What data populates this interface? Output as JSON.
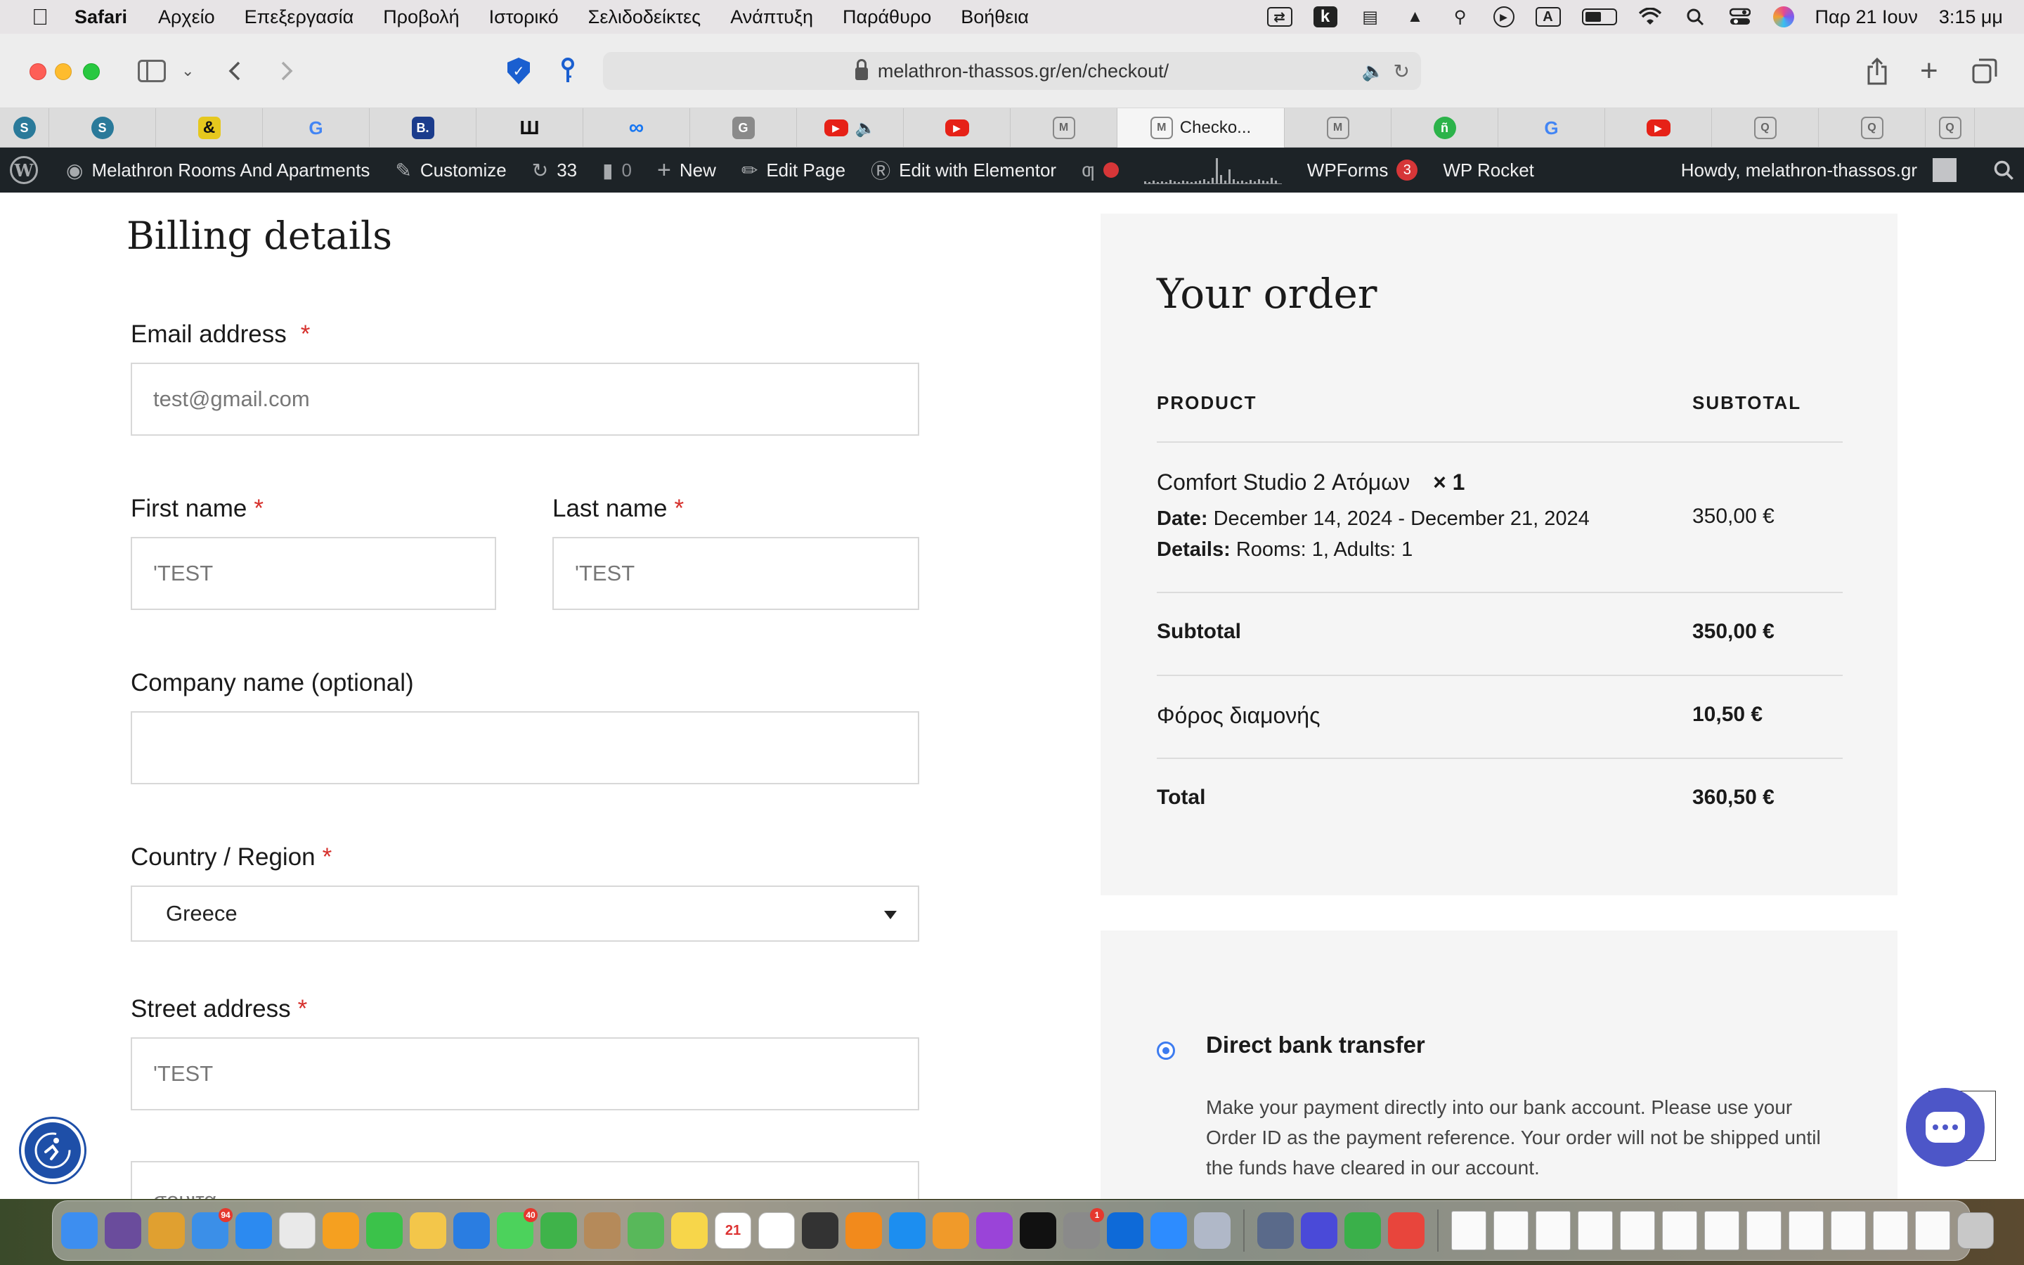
{
  "menubar": {
    "app_name": "Safari",
    "menus": [
      "Αρχείο",
      "Επεξεργασία",
      "Προβολή",
      "Ιστορικό",
      "Σελιδοδείκτες",
      "Ανάπτυξη",
      "Παράθυρο",
      "Βοήθεια"
    ],
    "date": "Παρ 21 Ιουν",
    "time": "3:15 μμ",
    "input_source": "A",
    "status_icons": [
      "screen-share-icon",
      "k-app-icon",
      "bed-icon",
      "flashlight-icon",
      "key-icon",
      "play-icon",
      "input-source-icon",
      "battery-icon",
      "wifi-icon",
      "spotlight-icon",
      "control-center-icon",
      "siri-icon"
    ]
  },
  "browser": {
    "url": "melathron-thassos.gr/en/checkout/",
    "colors": {
      "shield": "#1a5fd0",
      "accent": "#3d7cf0"
    }
  },
  "tabs": [
    {
      "icon": "s-favicon",
      "label": "",
      "color": "#2a7a9a",
      "glyph": "S"
    },
    {
      "icon": "s-favicon",
      "label": "",
      "color": "#2a7a9a",
      "glyph": "S"
    },
    {
      "icon": "ampersand-favicon",
      "label": "",
      "color": "#e6c81e",
      "glyph": "&"
    },
    {
      "icon": "google-favicon",
      "label": "",
      "color": "#ffffff",
      "glyph": "G"
    },
    {
      "icon": "booking-favicon",
      "label": "",
      "color": "#1b3c8c",
      "glyph": "B."
    },
    {
      "icon": "m-favicon",
      "label": "",
      "color": "#ffffff",
      "glyph": "Ш"
    },
    {
      "icon": "meta-favicon",
      "label": "",
      "color": "#ffffff",
      "glyph": "∞"
    },
    {
      "icon": "g-grey-favicon",
      "label": "",
      "color": "#8a8a8a",
      "glyph": "G"
    },
    {
      "icon": "youtube-favicon",
      "label": "",
      "color": "#e62117",
      "glyph": "▶",
      "muted": true
    },
    {
      "icon": "youtube-favicon",
      "label": "",
      "color": "#e62117",
      "glyph": "▶"
    },
    {
      "icon": "melathron-favicon",
      "label": "",
      "color": "#ffffff",
      "glyph": "M"
    },
    {
      "icon": "melathron-favicon",
      "label": "Checko...",
      "color": "#ffffff",
      "glyph": "M",
      "active": true
    },
    {
      "icon": "melathron-favicon",
      "label": "",
      "color": "#ffffff",
      "glyph": "M"
    },
    {
      "icon": "green-favicon",
      "label": "",
      "color": "#2cb34a",
      "glyph": "ñ"
    },
    {
      "icon": "google-favicon",
      "label": "",
      "color": "#ffffff",
      "glyph": "G"
    },
    {
      "icon": "youtube-favicon",
      "label": "",
      "color": "#e62117",
      "glyph": "▶"
    },
    {
      "icon": "loop-favicon",
      "label": "",
      "color": "#ffffff",
      "glyph": "Q"
    },
    {
      "icon": "loop-favicon",
      "label": "",
      "color": "#ffffff",
      "glyph": "Q"
    },
    {
      "icon": "loop-favicon",
      "label": "",
      "color": "#ffffff",
      "glyph": "Q"
    }
  ],
  "adminbar": {
    "site_name": "Melathron Rooms And Apartments",
    "customize": "Customize",
    "updates_count": "33",
    "comments_count": "0",
    "new_label": "New",
    "edit_page": "Edit Page",
    "elementor": "Edit with Elementor",
    "wpforms": "WPForms",
    "wpforms_badge": "3",
    "wprocket": "WP Rocket",
    "howdy": "Howdy, melathron-thassos.gr"
  },
  "billing": {
    "title": "Billing details",
    "email_label": "Email address",
    "email_value": "test@gmail.com",
    "first_name_label": "First name",
    "first_name_value": "'TEST",
    "last_name_label": "Last name",
    "last_name_value": "'TEST",
    "company_label": "Company name (optional)",
    "company_value": "",
    "country_label": "Country / Region",
    "country_value": "Greece",
    "street_label": "Street address",
    "street_value": "'TEST",
    "next_field_value": "σουιτα",
    "required_mark": "*"
  },
  "order": {
    "title": "Your order",
    "col_product": "PRODUCT",
    "col_subtotal": "SUBTOTAL",
    "item_name": "Comfort Studio 2 Ατόμων",
    "item_qty": "× 1",
    "date_label": "Date:",
    "date_value": "December 14, 2024 - December 21, 2024",
    "details_label": "Details:",
    "details_value": "Rooms: 1, Adults: 1",
    "item_price": "350,00 €",
    "subtotal_label": "Subtotal",
    "subtotal_value": "350,00 €",
    "tax_label": "Φόρος διαμονής",
    "tax_value": "10,50 €",
    "total_label": "Total",
    "total_value": "360,50 €"
  },
  "payment": {
    "method_title": "Direct bank transfer",
    "description": "Make your payment directly into our bank account. Please use your Order ID as the payment reference. Your order will not be shipped until the funds have cleared in our account."
  },
  "dock": {
    "apps": [
      {
        "name": "finder-icon",
        "color": "#3d8ef0"
      },
      {
        "name": "launchpad-icon",
        "color": "#6a4c9c"
      },
      {
        "name": "launchpad-grid-icon",
        "color": "#e0a030"
      },
      {
        "name": "mail-icon",
        "color": "#3b8fe8",
        "badge": "94"
      },
      {
        "name": "safari-icon",
        "color": "#2c8af0"
      },
      {
        "name": "chrome-icon",
        "color": "#e9e9e9"
      },
      {
        "name": "pages-icon",
        "color": "#f5a020"
      },
      {
        "name": "facetime-icon",
        "color": "#3bc24a"
      },
      {
        "name": "photos-icon",
        "color": "#f3c64a"
      },
      {
        "name": "keynote-icon",
        "color": "#2a7de1"
      },
      {
        "name": "messages-icon",
        "color": "#4cd25c",
        "badge": "40"
      },
      {
        "name": "numbers-icon",
        "color": "#3fb34a"
      },
      {
        "name": "contacts-icon",
        "color": "#b58a5a"
      },
      {
        "name": "maps-icon",
        "color": "#58b85a"
      },
      {
        "name": "notes-icon",
        "color": "#f7d64a"
      },
      {
        "name": "calendar-icon",
        "color": "#ffffff",
        "glyph": "21"
      },
      {
        "name": "reminders-icon",
        "color": "#ffffff"
      },
      {
        "name": "calculator-icon",
        "color": "#333333"
      },
      {
        "name": "vlc-icon",
        "color": "#f28a1c"
      },
      {
        "name": "app-store-icon",
        "color": "#1c8ef0"
      },
      {
        "name": "books-icon",
        "color": "#f09a2a"
      },
      {
        "name": "podcasts-icon",
        "color": "#9a44d8"
      },
      {
        "name": "apple-tv-icon",
        "color": "#111111"
      },
      {
        "name": "system-preferences-icon",
        "color": "#8a8a8a",
        "badge": "1"
      },
      {
        "name": "teamviewer-icon",
        "color": "#0e6ad8"
      },
      {
        "name": "zoom-icon",
        "color": "#2d8cff"
      },
      {
        "name": "utility-icon",
        "color": "#b0b8c8"
      }
    ],
    "after_sep": [
      {
        "name": "preview-icon",
        "color": "#5a6a8a"
      },
      {
        "name": "shortcuts-icon",
        "color": "#4a4ad8"
      },
      {
        "name": "vpn-icon",
        "color": "#3ab04a"
      },
      {
        "name": "anydesk-icon",
        "color": "#e8453c"
      }
    ],
    "doc_count": 12
  }
}
